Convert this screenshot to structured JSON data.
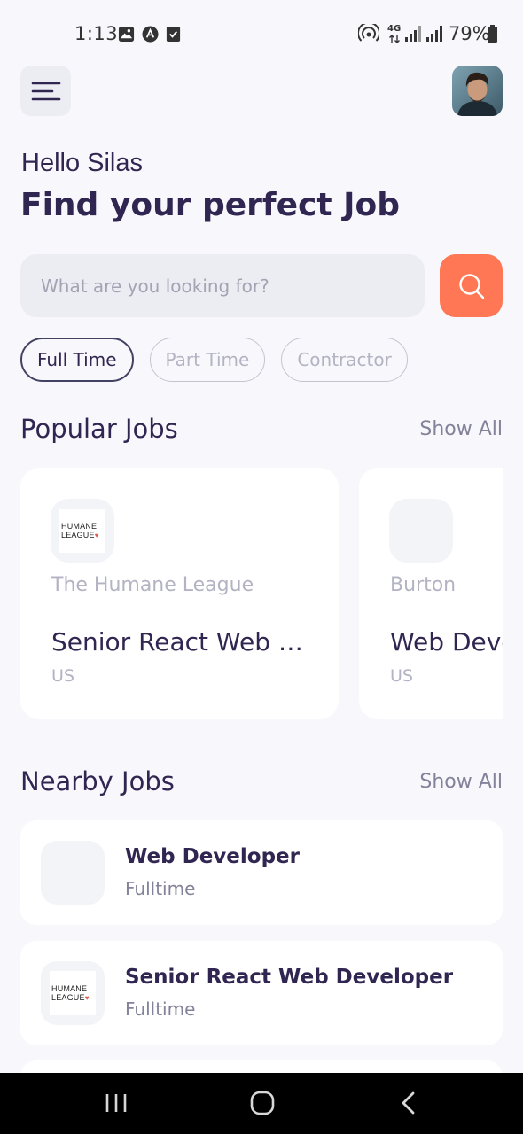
{
  "status_bar": {
    "time": "1:13",
    "network": "4G",
    "battery": "79%",
    "icons": [
      "gallery-icon",
      "app-icon",
      "check-icon",
      "hotspot-icon",
      "signal-icon",
      "battery-icon"
    ]
  },
  "header": {
    "menu_icon": "menu-icon",
    "avatar_icon": "avatar"
  },
  "welcome": {
    "greeting": "Hello Silas",
    "headline": "Find your perfect Job"
  },
  "search": {
    "placeholder": "What are you looking for?",
    "value": "",
    "button_icon": "search-icon"
  },
  "job_types": [
    {
      "label": "Full Time",
      "active": true
    },
    {
      "label": "Part Time",
      "active": false
    },
    {
      "label": "Contractor",
      "active": false
    }
  ],
  "popular": {
    "title": "Popular Jobs",
    "show_all": "Show All",
    "jobs": [
      {
        "company": "The Humane League",
        "logo_lines": [
          "HUMANE",
          "LEAGUE"
        ],
        "title": "Senior React Web Developer",
        "location": "US"
      },
      {
        "company": "Burton",
        "logo_lines": [],
        "title": "Web Developer",
        "location": "US"
      }
    ]
  },
  "nearby": {
    "title": "Nearby Jobs",
    "show_all": "Show All",
    "jobs": [
      {
        "title": "Web Developer",
        "type": "Fulltime",
        "logo_lines": []
      },
      {
        "title": "Senior React Web Developer",
        "type": "Fulltime",
        "logo_lines": [
          "HUMANE",
          "LEAGUE"
        ]
      }
    ]
  },
  "colors": {
    "primary": "#312651",
    "accent": "#ff7754",
    "gray": "#83829a",
    "light_gray": "#b3b3c3",
    "background": "#f8f8fc"
  }
}
